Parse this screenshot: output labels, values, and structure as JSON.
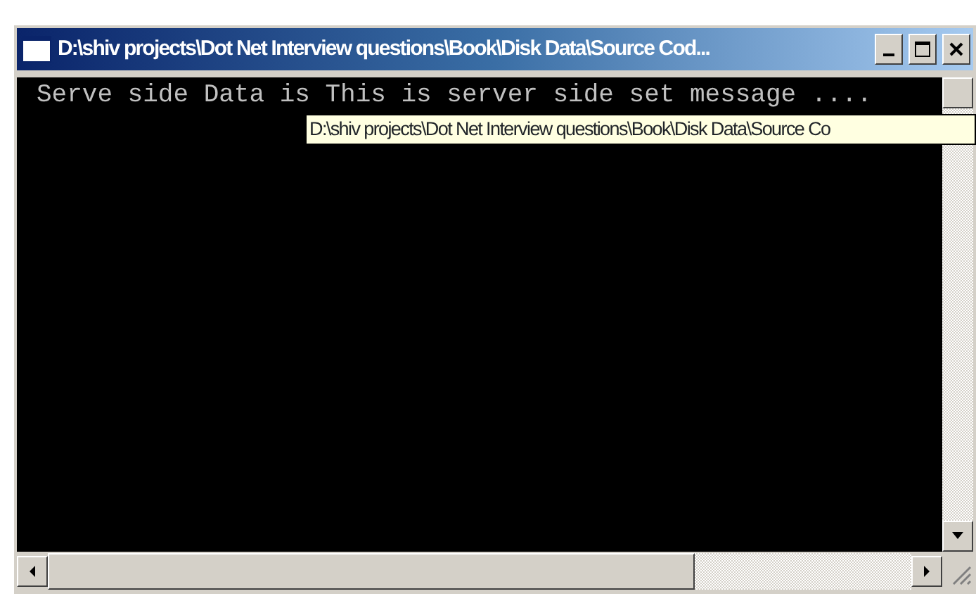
{
  "window": {
    "title": "D:\\shiv projects\\Dot Net Interview questions\\Book\\Disk Data\\Source Cod..."
  },
  "console": {
    "lines": [
      "Serve side Data is This is server side set message ...."
    ]
  },
  "tooltip": {
    "text": "D:\\shiv projects\\Dot Net Interview questions\\Book\\Disk Data\\Source Co"
  }
}
